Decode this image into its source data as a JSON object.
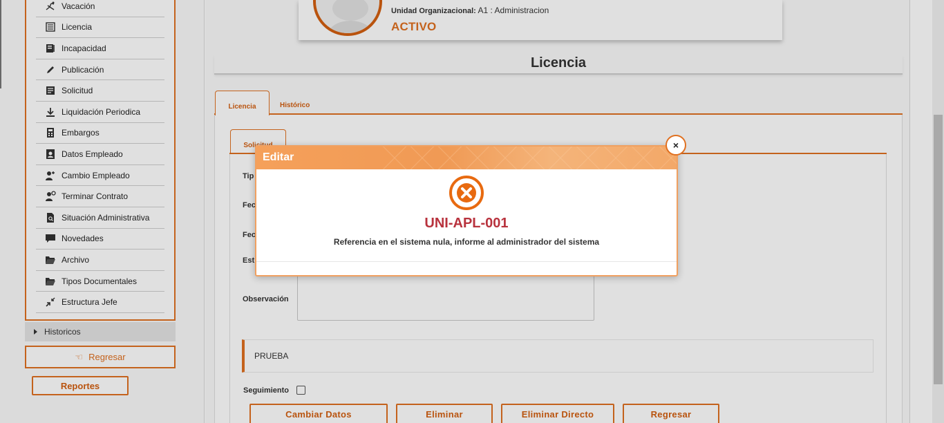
{
  "sidebar": {
    "items": [
      {
        "label": "Vacación",
        "icon": "beach-chair-icon"
      },
      {
        "label": "Licencia",
        "icon": "list-document-icon"
      },
      {
        "label": "Incapacidad",
        "icon": "book-stack-icon"
      },
      {
        "label": "Publicación",
        "icon": "pencil-icon"
      },
      {
        "label": "Solicitud",
        "icon": "form-icon"
      },
      {
        "label": "Liquidación Periodica",
        "icon": "download-icon"
      },
      {
        "label": "Embargos",
        "icon": "calculator-icon"
      },
      {
        "label": "Datos Empleado",
        "icon": "id-card-icon"
      },
      {
        "label": "Cambio Empleado",
        "icon": "user-edit-icon"
      },
      {
        "label": "Terminar Contrato",
        "icon": "user-remove-icon"
      },
      {
        "label": "Situación Administrativa",
        "icon": "document-search-icon"
      },
      {
        "label": "Novedades",
        "icon": "chat-icon"
      },
      {
        "label": "Archivo",
        "icon": "folder-open-icon"
      },
      {
        "label": "Tipos Documentales",
        "icon": "folder-open-icon"
      },
      {
        "label": "Estructura Jefe",
        "icon": "compress-arrows-icon"
      }
    ],
    "historicos_label": "Historicos",
    "regresar_label": "Regresar",
    "reportes_label": "Reportes"
  },
  "profile": {
    "unidad_label": "Unidad Organizacional:",
    "unidad_value": "A1 : Administracion",
    "status": "ACTIVO"
  },
  "page_title": "Licencia",
  "tabs": {
    "licencia": "Licencia",
    "historico": "Histórico",
    "subtab": "Solicitud"
  },
  "form": {
    "label_tipo": "Tip",
    "label_fecha1": "Fec",
    "label_fecha2": "Fec",
    "label_estado": "Est",
    "label_observacion": "Observación",
    "note": "PRUEBA",
    "seguimiento_label": "Seguimiento"
  },
  "buttons": {
    "cambiar": "Cambiar Datos",
    "eliminar": "Eliminar",
    "eliminar_directo": "Eliminar Directo",
    "regresar": "Regresar"
  },
  "modal": {
    "title": "Editar",
    "error_code": "UNI-APL-001",
    "message": "Referencia en el sistema nula, informe al administrador del sistema",
    "close_glyph": "×"
  },
  "colors": {
    "accent": "#e07020",
    "error_code": "#b8323d"
  }
}
